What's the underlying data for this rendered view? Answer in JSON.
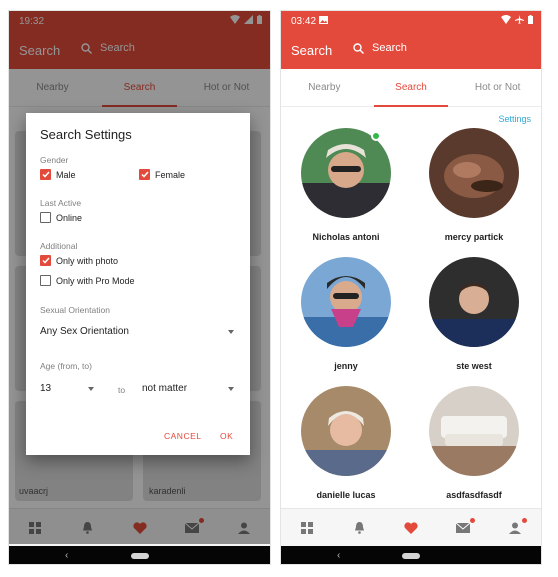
{
  "colors": {
    "accent": "#e44a3c",
    "accent_dark": "#7c2b24",
    "link": "#30a9d9",
    "online": "#34b84b"
  },
  "left": {
    "status": {
      "time": "19:32"
    },
    "appbar": {
      "title": "Search",
      "search_placeholder": "Search"
    },
    "tabs": [
      "Nearby",
      "Search",
      "Hot or Not"
    ],
    "background_names": [
      "uvaacrj",
      "karadenli"
    ],
    "dialog": {
      "title": "Search Settings",
      "gender_label": "Gender",
      "male": "Male",
      "female": "Female",
      "last_active_label": "Last Active",
      "online": "Online",
      "additional_label": "Additional",
      "only_with_photo": "Only with photo",
      "only_with_pro": "Only with Pro Mode",
      "orientation_label": "Sexual Orientation",
      "orientation_value": "Any Sex Orientation",
      "age_label": "Age (from, to)",
      "age_from": "13",
      "age_to_word": "to",
      "age_to": "not matter",
      "cancel": "CANCEL",
      "ok": "OK",
      "checked": {
        "male": true,
        "female": true,
        "online": false,
        "photo": true,
        "pro": false
      }
    }
  },
  "right": {
    "status": {
      "time": "03:42"
    },
    "appbar": {
      "title": "Search",
      "search_placeholder": "Search"
    },
    "tabs": [
      "Nearby",
      "Search",
      "Hot or Not"
    ],
    "settings_link": "Settings",
    "users": [
      {
        "name": "Nicholas antoni",
        "online": true
      },
      {
        "name": "mercy partick",
        "online": false
      },
      {
        "name": "jenny",
        "online": false
      },
      {
        "name": "ste west",
        "online": false
      },
      {
        "name": "danielle lucas",
        "online": false
      },
      {
        "name": "asdfasdfasdf",
        "online": false
      }
    ]
  },
  "icons": [
    "grid-icon",
    "bell-icon",
    "heart-icon",
    "mail-icon",
    "person-icon"
  ],
  "nav": {
    "back_glyph": "‹"
  }
}
